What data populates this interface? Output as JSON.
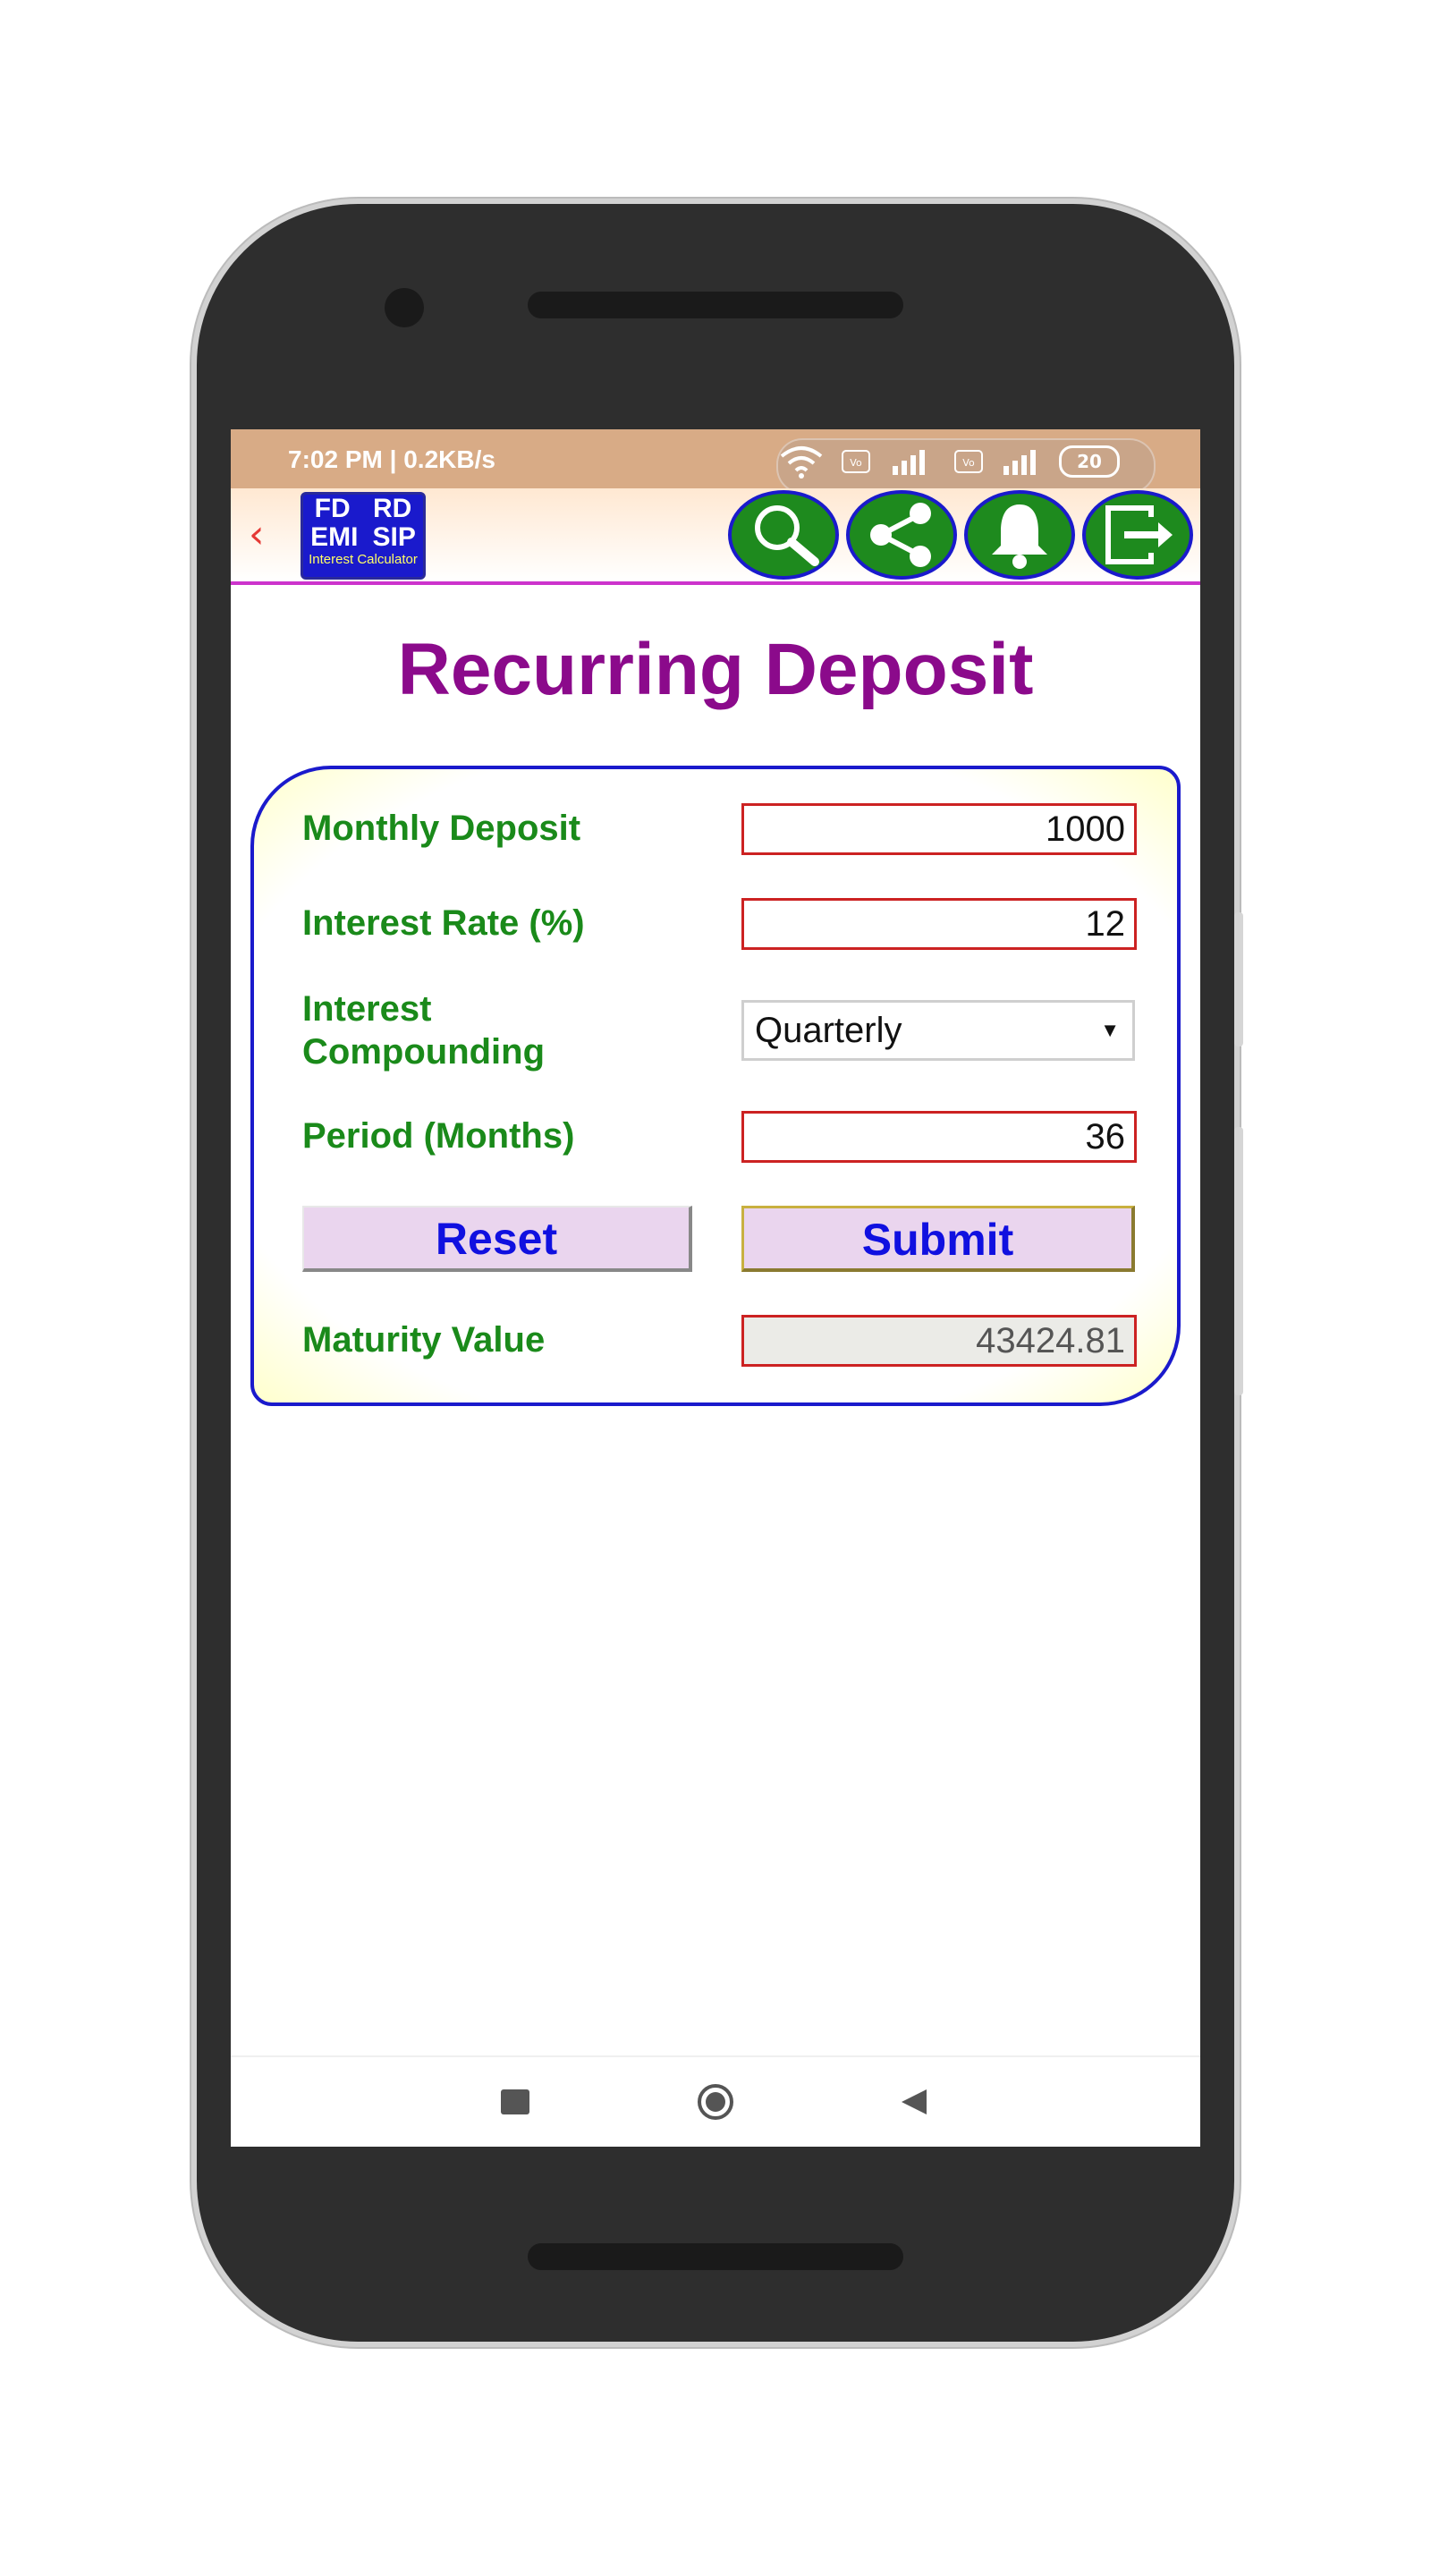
{
  "status_bar": {
    "time_and_speed": "7:02 PM | 0.2KB/s",
    "battery": "20"
  },
  "app_bar": {
    "logo": {
      "line1_left": "FD",
      "line1_right": "RD",
      "line2_left": "EMI",
      "line2_right": "SIP",
      "subtitle": "Interest Calculator"
    },
    "icons": [
      "search-icon",
      "share-icon",
      "bell-icon",
      "exit-icon"
    ]
  },
  "page": {
    "title": "Recurring Deposit"
  },
  "form": {
    "monthly_deposit": {
      "label": "Monthly Deposit",
      "value": "1000"
    },
    "interest_rate": {
      "label": "Interest Rate (%)",
      "value": "12"
    },
    "interest_compounding": {
      "label_line1": "Interest",
      "label_line2": "Compounding",
      "selected": "Quarterly"
    },
    "period": {
      "label": "Period (Months)",
      "value": "36"
    },
    "reset_label": "Reset",
    "submit_label": "Submit",
    "maturity": {
      "label": "Maturity Value",
      "value": "43424.81"
    }
  },
  "colors": {
    "title": "#8b0a8b",
    "label": "#1a8a1a",
    "button_text": "#1010e0",
    "panel_border": "#1a1acc",
    "status_bar": "#d8ab86"
  }
}
